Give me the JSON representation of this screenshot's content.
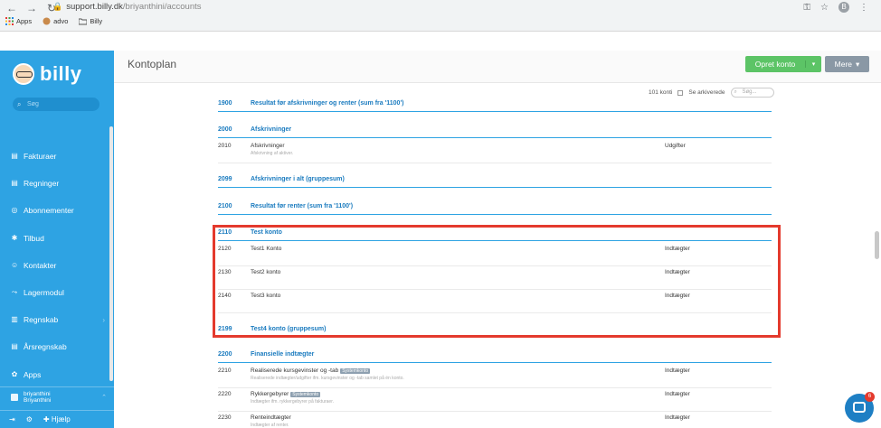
{
  "browser": {
    "url_host": "support.billy.dk",
    "url_path": "/briyanthini/accounts",
    "bookmarks": [
      "Apps",
      "advo",
      "Billy"
    ],
    "profile_initial": "B"
  },
  "sidebar": {
    "brand": "billy",
    "search_placeholder": "Søg",
    "items": [
      {
        "label": "Fakturaer",
        "icon": "invoice-icon"
      },
      {
        "label": "Regninger",
        "icon": "bill-icon"
      },
      {
        "label": "Abonnementer",
        "icon": "subscription-icon"
      },
      {
        "label": "Tilbud",
        "icon": "offer-icon"
      },
      {
        "label": "Kontakter",
        "icon": "contacts-icon"
      },
      {
        "label": "Lagermodul",
        "icon": "inventory-icon"
      },
      {
        "label": "Regnskab",
        "icon": "accounting-icon"
      },
      {
        "label": "Årsregnskab",
        "icon": "annual-report-icon"
      },
      {
        "label": "Apps",
        "icon": "apps-icon"
      }
    ],
    "user_name": "briyanthini",
    "user_org": "Briyanthini",
    "help_label": "Hjælp"
  },
  "header": {
    "title": "Kontoplan",
    "create_button": "Opret konto",
    "more_button": "Mere"
  },
  "toolbar": {
    "count": "101 konti",
    "archived_label": "Se arkiverede",
    "search_placeholder": "Søg..."
  },
  "accounts": {
    "g1900": {
      "num": "1900",
      "name": "Resultat før afskrivninger og renter (sum fra '1100')"
    },
    "g2000": {
      "num": "2000",
      "name": "Afskrivninger"
    },
    "a2010": {
      "num": "2010",
      "name": "Afskrivninger",
      "desc": "Afskrivning af aktiver.",
      "type": "Udgifter"
    },
    "g2099": {
      "num": "2099",
      "name": "Afskrivninger i alt (gruppesum)"
    },
    "g2100": {
      "num": "2100",
      "name": "Resultat før renter (sum fra '1100')"
    },
    "g2110": {
      "num": "2110",
      "name": "Test konto"
    },
    "a2120": {
      "num": "2120",
      "name": "Test1 Konto",
      "type": "Indtægter"
    },
    "a2130": {
      "num": "2130",
      "name": "Test2 konto",
      "type": "Indtægter"
    },
    "a2140": {
      "num": "2140",
      "name": "Test3 konto",
      "type": "Indtægter"
    },
    "g2199": {
      "num": "2199",
      "name": "Test4 konto (gruppesum)"
    },
    "g2200": {
      "num": "2200",
      "name": "Finansielle indtægter"
    },
    "a2210": {
      "num": "2210",
      "name": "Realiserede kursgevinster og -tab",
      "badge": "Systemkonto",
      "desc": "Realiserede indtægter/udgifter ifm. kursgevinster og -tab samlet på én konto.",
      "type": "Indtægter"
    },
    "a2220": {
      "num": "2220",
      "name": "Rykkergebyrer",
      "badge": "Systemkonto",
      "desc": "Indtægter ifm. rykkergebyrer på fakturaer.",
      "type": "Indtægter"
    },
    "a2230": {
      "num": "2230",
      "name": "Renteindtægter",
      "desc": "Indtægter af renter.",
      "type": "Indtægter"
    }
  },
  "chat": {
    "badge": "6"
  },
  "colors": {
    "sidebar": "#2ea3e3",
    "green": "#5cc466",
    "highlight": "#e43a2d"
  }
}
